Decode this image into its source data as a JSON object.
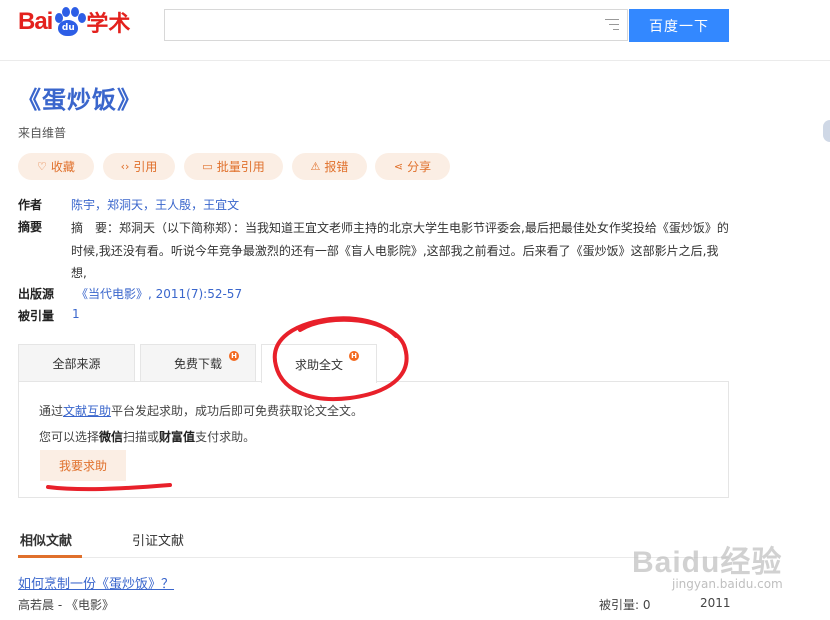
{
  "header": {
    "logo_bai": "Bai",
    "logo_du": "du",
    "logo_xueshu": "学术",
    "search_value": "",
    "search_button": "百度一下"
  },
  "paper": {
    "title": "《蛋炒饭》",
    "source_note": "来自维普"
  },
  "actions": [
    {
      "icon": "heart-icon",
      "label": "收藏"
    },
    {
      "icon": "code-icon",
      "label": "引用"
    },
    {
      "icon": "folder-icon",
      "label": "批量引用"
    },
    {
      "icon": "warning-icon",
      "label": "报错"
    },
    {
      "icon": "share-icon",
      "label": "分享"
    }
  ],
  "meta": {
    "author_label": "作者",
    "authors": [
      "陈宇",
      "郑洞天",
      "王人殷",
      "王宜文"
    ],
    "abstract_label": "摘要",
    "abstract_text": "摘　要：郑洞天（以下简称郑）：当我知道王宜文老师主持的北京大学生电影节评委会,最后把最佳处女作奖投给《蛋炒饭》的时候,我还没有看。听说今年竞争最激烈的还有一部《盲人电影院》,这部我之前看过。后来看了《蛋炒饭》这部影片之后,我想,",
    "publisher_label": "出版源",
    "publisher_value": "《当代电影》, 2011(7):52-57",
    "cited_label": "被引量",
    "cited_value": "1"
  },
  "tabs": [
    {
      "label": "全部来源",
      "badge": ""
    },
    {
      "label": "免费下载",
      "badge": "H"
    },
    {
      "label": "求助全文",
      "badge": "H"
    }
  ],
  "help_panel": {
    "line1_pre": "通过",
    "line1_link": "文献互助",
    "line1_post": "平台发起求助，成功后即可免费获取论文全文。",
    "line2_pre": "您可以选择",
    "line2_b1": "微信",
    "line2_mid": "扫描或",
    "line2_b2": "财富值",
    "line2_post": "支付求助。",
    "button": "我要求助"
  },
  "related": {
    "tab_similar": "相似文献",
    "tab_citing": "引证文献",
    "results": [
      {
        "title": "如何烹制一份《蛋炒饭》？",
        "meta": "高若晨 - 《电影》",
        "cited": "被引量: 0",
        "year": "2011"
      }
    ]
  },
  "watermark": {
    "main": "Baidu经验",
    "sub": "jingyan.baidu.com"
  },
  "colors": {
    "brand_red": "#e3211d",
    "brand_blue": "#3388ff",
    "link_blue": "#3a66cc",
    "accent_orange": "#e0702b",
    "annotation_red": "#e8202a"
  }
}
